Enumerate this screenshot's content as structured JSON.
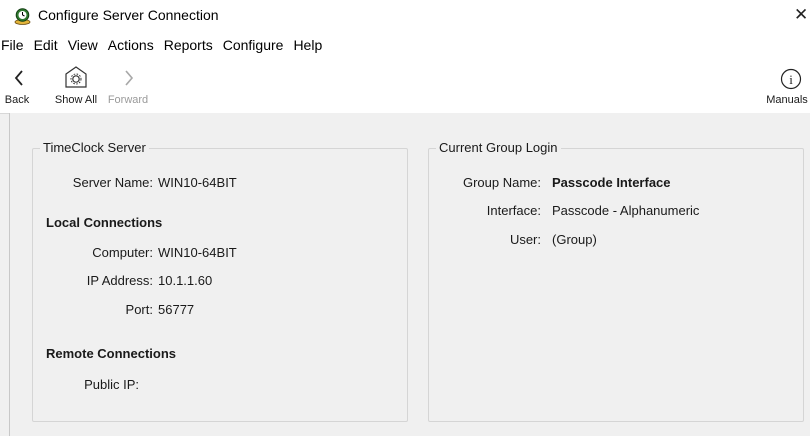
{
  "window": {
    "title": "Configure Server Connection",
    "close_glyph": "✕"
  },
  "menu": [
    "File",
    "Edit",
    "View",
    "Actions",
    "Reports",
    "Configure",
    "Help"
  ],
  "toolbar": {
    "back_label": "Back",
    "show_all_label": "Show All",
    "forward_label": "Forward",
    "manuals_label": "Manuals"
  },
  "timeclock_server": {
    "title": "TimeClock Server",
    "server_name_label": "Server Name:",
    "server_name_value": "WIN10-64BIT",
    "local_heading": "Local Connections",
    "computer_label": "Computer:",
    "computer_value": "WIN10-64BIT",
    "ip_label": "IP Address:",
    "ip_value": "10.1.1.60",
    "port_label": "Port:",
    "port_value": "56777",
    "remote_heading": "Remote Connections",
    "public_ip_label": "Public IP:",
    "public_ip_value": ""
  },
  "group_login": {
    "title": "Current Group Login",
    "group_name_label": "Group Name:",
    "group_name_value": "Passcode Interface",
    "interface_label": "Interface:",
    "interface_value": "Passcode - Alphanumeric",
    "user_label": "User:",
    "user_value": "(Group)"
  },
  "colors": {
    "app_icon_green": "#2f7a2f",
    "app_icon_gold": "#e2b43a"
  }
}
